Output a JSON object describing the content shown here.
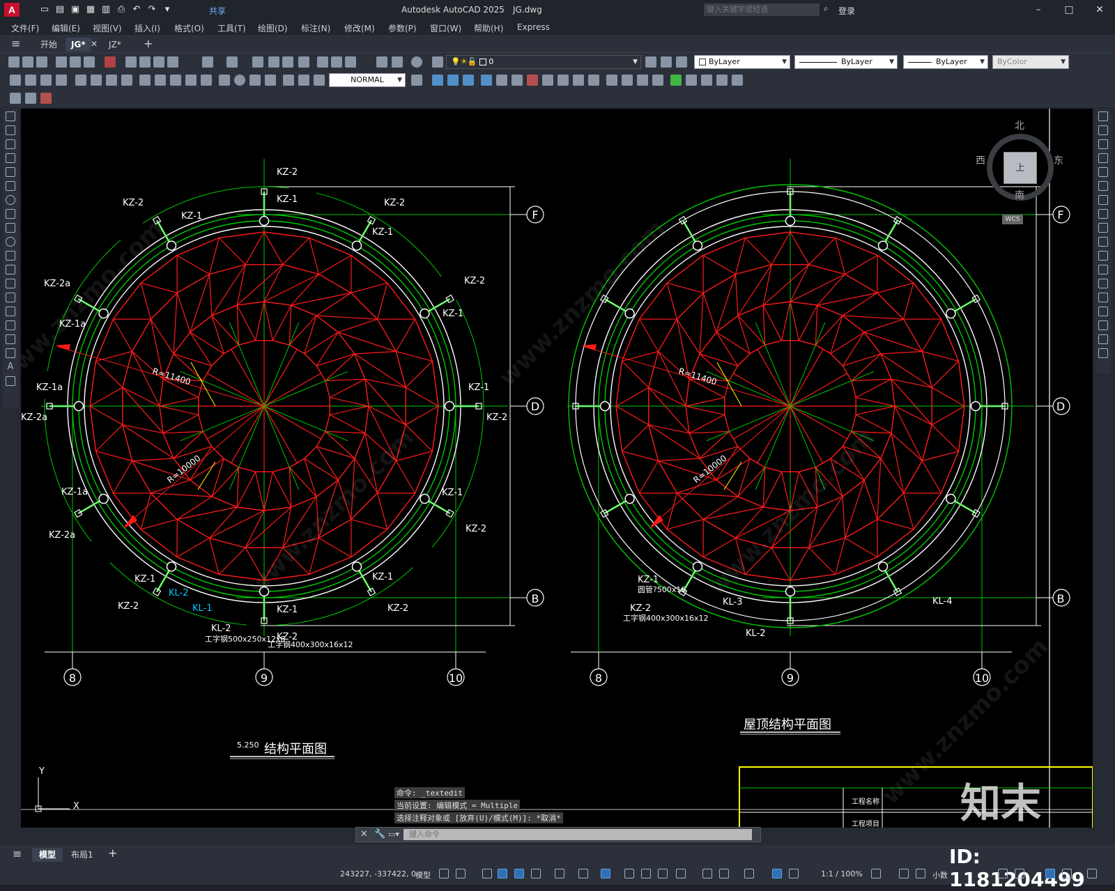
{
  "app": {
    "title": "Autodesk AutoCAD 2025",
    "document": "JG.dwg",
    "share": "共享",
    "search_placeholder": "键入关键字或短语",
    "login": "登录"
  },
  "menu": [
    "文件(F)",
    "编辑(E)",
    "视图(V)",
    "插入(I)",
    "格式(O)",
    "工具(T)",
    "绘图(D)",
    "标注(N)",
    "修改(M)",
    "参数(P)",
    "窗口(W)",
    "帮助(H)",
    "Express"
  ],
  "tabs": [
    {
      "label": "开始"
    },
    {
      "label": "JG*"
    },
    {
      "label": "JZ*"
    }
  ],
  "toolbar": {
    "layer": "0",
    "color": "ByLayer",
    "linetype": "ByLayer",
    "lineweight": "ByLayer",
    "plotstyle": "ByColor",
    "dimstyle": "NORMAL"
  },
  "viewcube": {
    "north": "北",
    "south": "南",
    "east": "东",
    "west": "西",
    "top": "上",
    "wcs": "WCS"
  },
  "drawing": {
    "left_title": "结构平面图",
    "left_elev": "5.250",
    "right_title": "屋顶结构平面图",
    "grid_rows": [
      "F",
      "D",
      "B"
    ],
    "grid_cols": [
      "8",
      "9",
      "10"
    ],
    "radius_outer": "R=11400",
    "radius_inner": "R=10000",
    "left_labels": {
      "kz2_top": "KZ-2",
      "kz1_top": "KZ-1",
      "kz2_tl": "KZ-2",
      "kz1_tl": "KZ-1",
      "kz2_tr": "KZ-2",
      "kz1_tr": "KZ-1",
      "kz2a_l1": "KZ-2a",
      "kz1a_l1": "KZ-1a",
      "kz2_r1": "KZ-2",
      "kz1_r1": "KZ-1",
      "kz1a_l2": "KZ-1a",
      "kz2a_l2": "KZ-2a",
      "kz1_r2": "KZ-1",
      "kz2_r2": "KZ-2",
      "kz1a_l3": "KZ-1a",
      "kz2a_l3": "KZ-2a",
      "kz1_r3": "KZ-1",
      "kz2_r3": "KZ-2",
      "kz1_bl": "KZ-1",
      "kz2_bl": "KZ-2",
      "kl2_cyan": "KL-2",
      "kl1_cyan": "KL-1",
      "kz1_br": "KZ-1",
      "kz2_br": "KZ-2",
      "kz1_bot": "KZ-1",
      "kz2_bot": "KZ-2",
      "kl2_bot": "KL-2",
      "beam1": "工字钢500x250x12x8",
      "beam2": "工字钢400x300x16x12"
    },
    "right_labels": {
      "kz1": "KZ-1",
      "pipe": "圆管?500x16",
      "kz2": "KZ-2",
      "beam": "工字钢400x300x16x12",
      "kl3": "KL-3",
      "kl2": "KL-2",
      "kl4": "KL-4"
    },
    "titleblock": {
      "project": "工程名称",
      "sub": "工程项目"
    },
    "ucs_x": "X",
    "ucs_y": "Y"
  },
  "watermark": {
    "brand": "知末",
    "id": "ID: 1181204499",
    "url": "www.znzmo.com"
  },
  "command": {
    "history": [
      "命令: _textedit",
      "当前设置: 编辑模式 = Multiple",
      "选择注释对象或 [放弃(U)/模式(M)]: *取消*"
    ],
    "placeholder": "键入命令"
  },
  "layouts": [
    {
      "label": "模型"
    },
    {
      "label": "布局1"
    }
  ],
  "status": {
    "coords": "243227, -337422, 0",
    "mode": "模型",
    "scale": "1:1 / 100%",
    "units": "小数"
  },
  "colors": {
    "red": "#ff1a1a",
    "green": "#00c800",
    "white": "#ffffff",
    "yellow": "#ffff00",
    "cyan": "#00c8ff"
  }
}
